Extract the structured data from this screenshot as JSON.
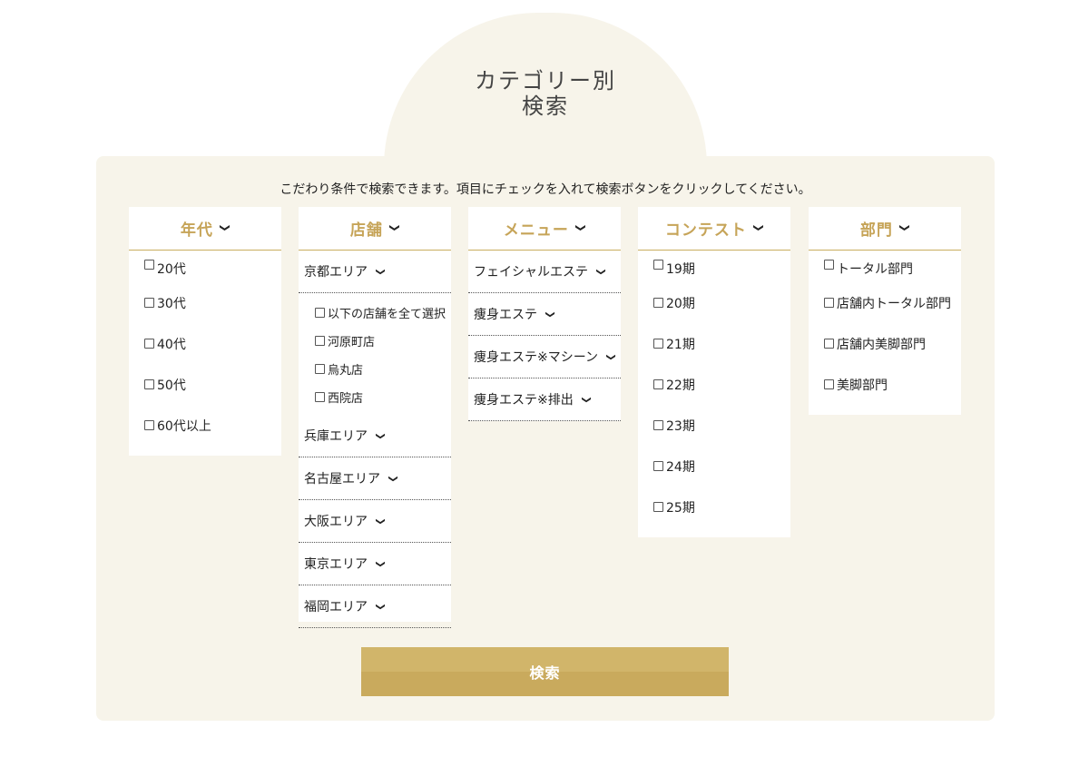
{
  "heading": {
    "line1": "カテゴリー別",
    "line2": "検索"
  },
  "intro": "こだわり条件で検索できます。項目にチェックを入れて検索ボタンをクリックしてください。",
  "columns": {
    "age": {
      "title": "年代",
      "items": [
        "20代",
        "30代",
        "40代",
        "50代",
        "60代以上"
      ]
    },
    "store": {
      "title": "店舗",
      "areas": [
        {
          "label": "京都エリア",
          "expanded": true,
          "sub_items": [
            "以下の店舗を全て選択",
            "河原町店",
            "烏丸店",
            "西院店"
          ]
        },
        {
          "label": "兵庫エリア"
        },
        {
          "label": "名古屋エリア"
        },
        {
          "label": "大阪エリア"
        },
        {
          "label": "東京エリア"
        },
        {
          "label": "福岡エリア"
        }
      ]
    },
    "menu": {
      "title": "メニュー",
      "items": [
        "フェイシャルエステ",
        "痩身エステ",
        "痩身エステ※マシーン",
        "痩身エステ※排出"
      ]
    },
    "contest": {
      "title": "コンテスト",
      "items": [
        "19期",
        "20期",
        "21期",
        "22期",
        "23期",
        "24期",
        "25期"
      ]
    },
    "division": {
      "title": "部門",
      "items": [
        "トータル部門",
        "店舗内トータル部門",
        "店舗内美脚部門",
        "美脚部門"
      ]
    }
  },
  "search_button": "検索",
  "icons": {
    "expand": "chevron-down-icon",
    "checkbox": "checkbox-icon"
  },
  "colors": {
    "accent": "#c6a458",
    "panel_bg": "#f7f4ea",
    "button": "#d1b56a"
  }
}
